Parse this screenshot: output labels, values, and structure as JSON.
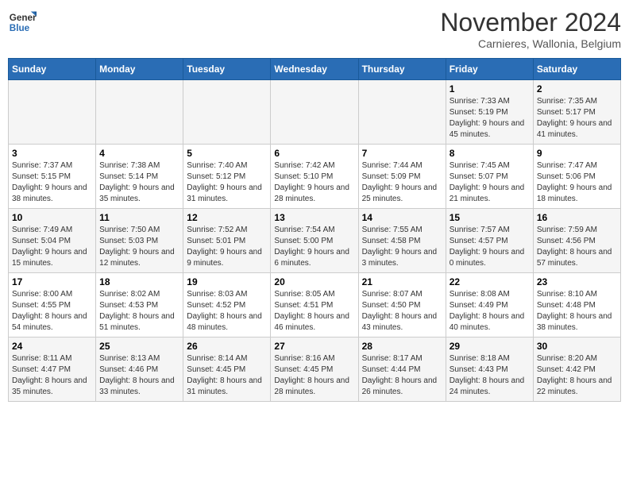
{
  "logo": {
    "line1": "General",
    "line2": "Blue"
  },
  "title": "November 2024",
  "subtitle": "Carnieres, Wallonia, Belgium",
  "weekdays": [
    "Sunday",
    "Monday",
    "Tuesday",
    "Wednesday",
    "Thursday",
    "Friday",
    "Saturday"
  ],
  "weeks": [
    [
      {
        "day": "",
        "info": ""
      },
      {
        "day": "",
        "info": ""
      },
      {
        "day": "",
        "info": ""
      },
      {
        "day": "",
        "info": ""
      },
      {
        "day": "",
        "info": ""
      },
      {
        "day": "1",
        "info": "Sunrise: 7:33 AM\nSunset: 5:19 PM\nDaylight: 9 hours and 45 minutes."
      },
      {
        "day": "2",
        "info": "Sunrise: 7:35 AM\nSunset: 5:17 PM\nDaylight: 9 hours and 41 minutes."
      }
    ],
    [
      {
        "day": "3",
        "info": "Sunrise: 7:37 AM\nSunset: 5:15 PM\nDaylight: 9 hours and 38 minutes."
      },
      {
        "day": "4",
        "info": "Sunrise: 7:38 AM\nSunset: 5:14 PM\nDaylight: 9 hours and 35 minutes."
      },
      {
        "day": "5",
        "info": "Sunrise: 7:40 AM\nSunset: 5:12 PM\nDaylight: 9 hours and 31 minutes."
      },
      {
        "day": "6",
        "info": "Sunrise: 7:42 AM\nSunset: 5:10 PM\nDaylight: 9 hours and 28 minutes."
      },
      {
        "day": "7",
        "info": "Sunrise: 7:44 AM\nSunset: 5:09 PM\nDaylight: 9 hours and 25 minutes."
      },
      {
        "day": "8",
        "info": "Sunrise: 7:45 AM\nSunset: 5:07 PM\nDaylight: 9 hours and 21 minutes."
      },
      {
        "day": "9",
        "info": "Sunrise: 7:47 AM\nSunset: 5:06 PM\nDaylight: 9 hours and 18 minutes."
      }
    ],
    [
      {
        "day": "10",
        "info": "Sunrise: 7:49 AM\nSunset: 5:04 PM\nDaylight: 9 hours and 15 minutes."
      },
      {
        "day": "11",
        "info": "Sunrise: 7:50 AM\nSunset: 5:03 PM\nDaylight: 9 hours and 12 minutes."
      },
      {
        "day": "12",
        "info": "Sunrise: 7:52 AM\nSunset: 5:01 PM\nDaylight: 9 hours and 9 minutes."
      },
      {
        "day": "13",
        "info": "Sunrise: 7:54 AM\nSunset: 5:00 PM\nDaylight: 9 hours and 6 minutes."
      },
      {
        "day": "14",
        "info": "Sunrise: 7:55 AM\nSunset: 4:58 PM\nDaylight: 9 hours and 3 minutes."
      },
      {
        "day": "15",
        "info": "Sunrise: 7:57 AM\nSunset: 4:57 PM\nDaylight: 9 hours and 0 minutes."
      },
      {
        "day": "16",
        "info": "Sunrise: 7:59 AM\nSunset: 4:56 PM\nDaylight: 8 hours and 57 minutes."
      }
    ],
    [
      {
        "day": "17",
        "info": "Sunrise: 8:00 AM\nSunset: 4:55 PM\nDaylight: 8 hours and 54 minutes."
      },
      {
        "day": "18",
        "info": "Sunrise: 8:02 AM\nSunset: 4:53 PM\nDaylight: 8 hours and 51 minutes."
      },
      {
        "day": "19",
        "info": "Sunrise: 8:03 AM\nSunset: 4:52 PM\nDaylight: 8 hours and 48 minutes."
      },
      {
        "day": "20",
        "info": "Sunrise: 8:05 AM\nSunset: 4:51 PM\nDaylight: 8 hours and 46 minutes."
      },
      {
        "day": "21",
        "info": "Sunrise: 8:07 AM\nSunset: 4:50 PM\nDaylight: 8 hours and 43 minutes."
      },
      {
        "day": "22",
        "info": "Sunrise: 8:08 AM\nSunset: 4:49 PM\nDaylight: 8 hours and 40 minutes."
      },
      {
        "day": "23",
        "info": "Sunrise: 8:10 AM\nSunset: 4:48 PM\nDaylight: 8 hours and 38 minutes."
      }
    ],
    [
      {
        "day": "24",
        "info": "Sunrise: 8:11 AM\nSunset: 4:47 PM\nDaylight: 8 hours and 35 minutes."
      },
      {
        "day": "25",
        "info": "Sunrise: 8:13 AM\nSunset: 4:46 PM\nDaylight: 8 hours and 33 minutes."
      },
      {
        "day": "26",
        "info": "Sunrise: 8:14 AM\nSunset: 4:45 PM\nDaylight: 8 hours and 31 minutes."
      },
      {
        "day": "27",
        "info": "Sunrise: 8:16 AM\nSunset: 4:45 PM\nDaylight: 8 hours and 28 minutes."
      },
      {
        "day": "28",
        "info": "Sunrise: 8:17 AM\nSunset: 4:44 PM\nDaylight: 8 hours and 26 minutes."
      },
      {
        "day": "29",
        "info": "Sunrise: 8:18 AM\nSunset: 4:43 PM\nDaylight: 8 hours and 24 minutes."
      },
      {
        "day": "30",
        "info": "Sunrise: 8:20 AM\nSunset: 4:42 PM\nDaylight: 8 hours and 22 minutes."
      }
    ]
  ]
}
